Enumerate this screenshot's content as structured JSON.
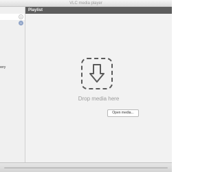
{
  "window": {
    "title": "VLC media player"
  },
  "sidebar": {
    "items": [
      {
        "label": "",
        "badge": "0",
        "badge_style": "white",
        "selected": true
      },
      {
        "label": "",
        "badge": "0",
        "badge_style": "blue",
        "selected": false
      },
      {
        "label": "overy",
        "badge": "",
        "selected": false
      },
      {
        "label": "",
        "badge": "",
        "selected": false
      },
      {
        "label": "y",
        "badge": "",
        "selected": false
      }
    ]
  },
  "header": {
    "title": "Playlist"
  },
  "drop": {
    "icon": "download-arrow-icon",
    "label": "Drop media here",
    "open_button": "Open media..."
  },
  "colors": {
    "header_bg": "#5d5d5d",
    "window_bg": "#ececec",
    "accent_badge": "#8fa3c7"
  }
}
